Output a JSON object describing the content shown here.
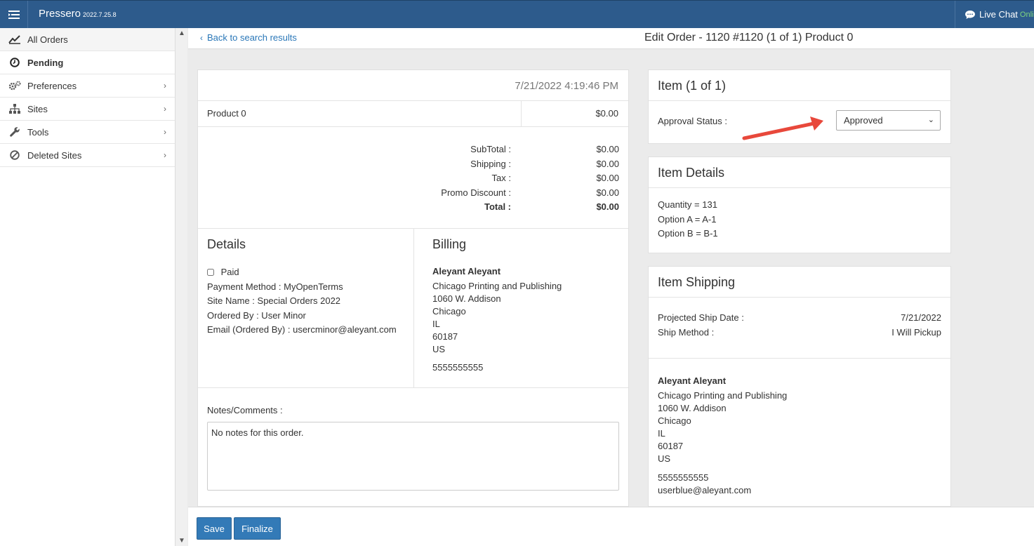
{
  "app": {
    "brand": "Pressero",
    "version": "2022.7.25.8",
    "live_chat": "Live Chat",
    "chat_status": "Onlin"
  },
  "sidebar": {
    "items": [
      {
        "label": "All Orders"
      },
      {
        "label": "Pending"
      },
      {
        "label": "Preferences"
      },
      {
        "label": "Sites"
      },
      {
        "label": "Tools"
      },
      {
        "label": "Deleted Sites"
      }
    ]
  },
  "header": {
    "back_link": "Back to search results",
    "title": "Edit Order - 1120 #1120 (1 of 1) Product 0"
  },
  "order": {
    "date": "7/21/2022 4:19:46 PM",
    "product_name": "Product 0",
    "product_price": "$0.00",
    "totals": [
      {
        "label": "SubTotal :",
        "value": "$0.00"
      },
      {
        "label": "Shipping :",
        "value": "$0.00"
      },
      {
        "label": "Tax :",
        "value": "$0.00"
      },
      {
        "label": "Promo Discount :",
        "value": "$0.00"
      },
      {
        "label": "Total :",
        "value": "$0.00"
      }
    ],
    "details": {
      "title": "Details",
      "paid_label": "Paid",
      "payment_method": "Payment Method : MyOpenTerms",
      "site_name": "Site Name : Special Orders 2022",
      "ordered_by": "Ordered By : User Minor",
      "email": "Email (Ordered By) : usercminor@aleyant.com"
    },
    "billing": {
      "title": "Billing",
      "name": "Aleyant Aleyant",
      "company": "Chicago Printing and Publishing",
      "street": "1060 W. Addison",
      "city": "Chicago",
      "state": "IL",
      "zip": "60187",
      "country": "US",
      "phone": "5555555555"
    },
    "notes_label": "Notes/Comments :",
    "notes": "No notes for this order."
  },
  "item": {
    "title": "Item (1 of 1)",
    "approval_label": "Approval Status :",
    "approval_value": "Approved"
  },
  "item_details": {
    "title": "Item Details",
    "lines": [
      "Quantity = 131",
      "Option A = A-1",
      "Option B = B-1"
    ]
  },
  "item_shipping": {
    "title": "Item Shipping",
    "ship_date_label": "Projected Ship Date :",
    "ship_date": "7/21/2022",
    "ship_method_label": "Ship Method :",
    "ship_method": "I Will Pickup",
    "name": "Aleyant Aleyant",
    "company": "Chicago Printing and Publishing",
    "street": "1060 W. Addison",
    "city": "Chicago",
    "state": "IL",
    "zip": "60187",
    "country": "US",
    "phone": "5555555555",
    "email": "userblue@aleyant.com"
  },
  "buttons": {
    "save": "Save",
    "finalize": "Finalize"
  },
  "colors": {
    "topbar": "#2d5b8c",
    "primary_button": "#337ab7",
    "link": "#2a77b8",
    "annotation_arrow": "#e8483b"
  }
}
